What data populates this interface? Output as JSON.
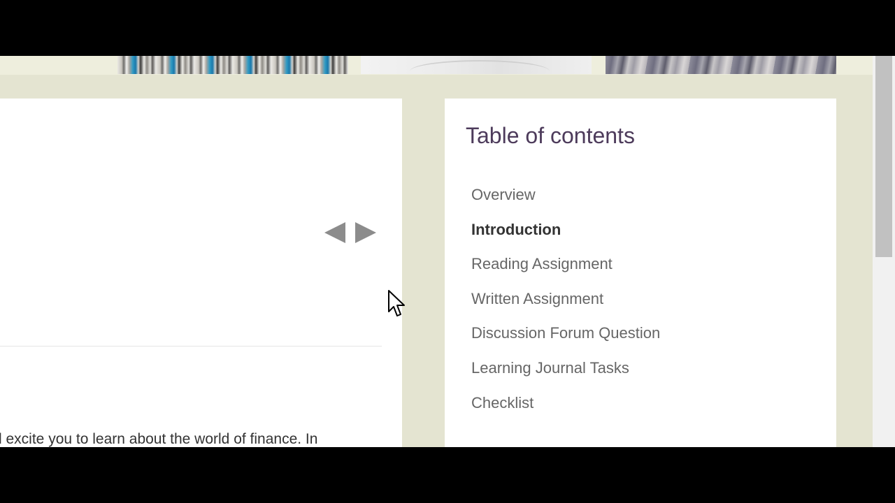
{
  "toc": {
    "title": "Table of contents",
    "items": [
      {
        "label": "Overview",
        "active": false
      },
      {
        "label": "Introduction",
        "active": true
      },
      {
        "label": "Reading Assignment",
        "active": false
      },
      {
        "label": "Written Assignment",
        "active": false
      },
      {
        "label": "Discussion Forum Question",
        "active": false
      },
      {
        "label": "Learning Journal Tasks",
        "active": false
      },
      {
        "label": "Checklist",
        "active": false
      }
    ]
  },
  "content": {
    "intro_text": "l excite you to learn about the world of finance. In"
  },
  "icons": {
    "prev": "left-triangle-icon",
    "next": "right-triangle-icon",
    "cursor": "mouse-pointer-icon"
  },
  "colors": {
    "page_background": "#e4e4d1",
    "toc_title": "#4d3b5b",
    "toc_item": "#666666",
    "toc_item_active": "#333333",
    "arrow": "#8c8c8c"
  }
}
